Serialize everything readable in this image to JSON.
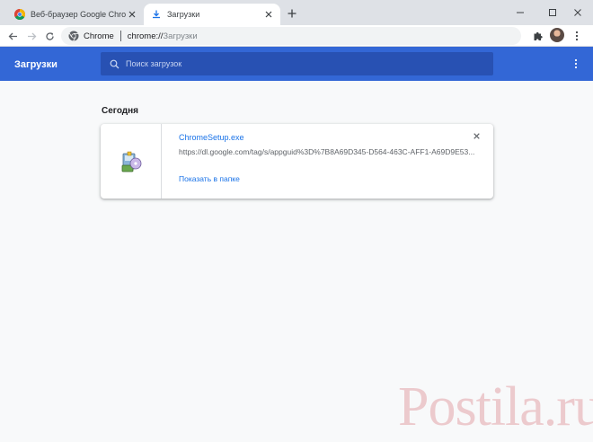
{
  "browser": {
    "tabs": [
      {
        "title": "Веб-браузер Google Chrome",
        "icon": "chrome-logo-icon",
        "active": false
      },
      {
        "title": "Загрузки",
        "icon": "download-icon",
        "active": true
      }
    ],
    "new_tab_icon": "plus-icon",
    "window_controls": [
      "minimize-icon",
      "maximize-icon",
      "close-icon"
    ],
    "omnibox": {
      "site_chip": "Chrome",
      "url_scheme": "chrome://",
      "url_path": "Загрузки"
    },
    "toolbar_icons": [
      "back-arrow-icon",
      "forward-arrow-icon",
      "reload-icon",
      "extensions-puzzle-icon",
      "profile-avatar",
      "kebab-menu-icon"
    ]
  },
  "downloads": {
    "title": "Загрузки",
    "search_placeholder": "Поиск загрузок",
    "date_heading": "Сегодня",
    "items": [
      {
        "file_name": "ChromeSetup.exe",
        "url": "https://dl.google.com/tag/s/appguid%3D%7B8A69D345-D564-463C-AFF1-A69D9E53...",
        "action": "Показать в папке",
        "icon": "installer-file-icon"
      }
    ]
  },
  "watermark_text": "Postila.ru",
  "colors": {
    "header_blue": "#3367d6",
    "link_blue": "#1a73e8",
    "tabstrip": "#dee1e6"
  }
}
